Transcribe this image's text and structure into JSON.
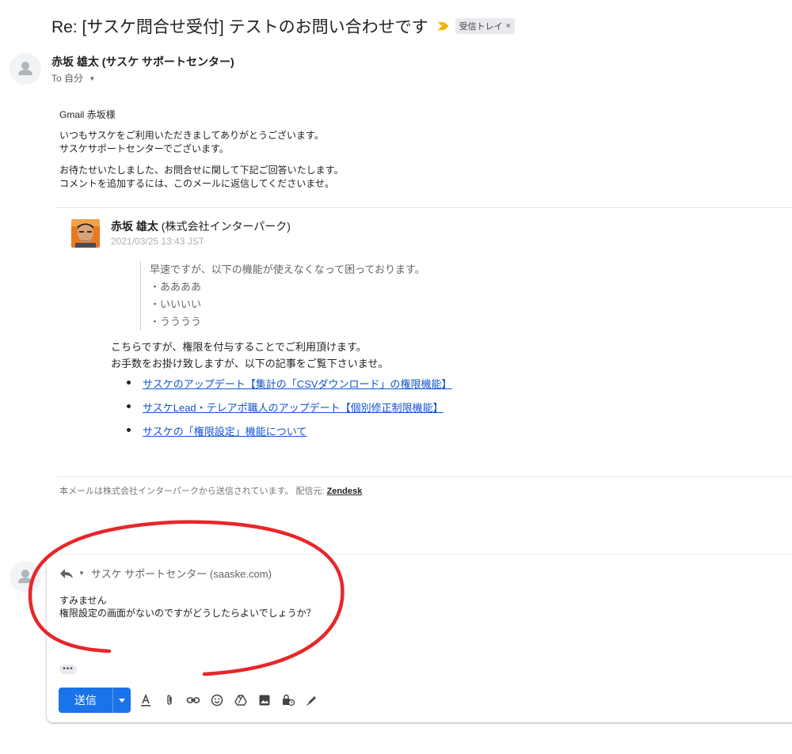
{
  "subject": "Re: [サスケ問合せ受付] テストのお問い合わせです",
  "label": {
    "name": "受信トレイ",
    "close": "×"
  },
  "message": {
    "sender": "赤坂 雄太 (サスケ サポートセンター)",
    "to": "To 自分",
    "greeting": "Gmail 赤坂様",
    "intro": [
      "いつもサスケをご利用いただきましてありがとうございます。",
      "サスケサポートセンターでございます。"
    ],
    "notice": [
      "お待たせいたしました、お問合せに関して下記ご回答いたします。",
      "コメントを追加するには、このメールに返信してくださいませ。"
    ]
  },
  "quoted": {
    "name": "赤坂 雄太",
    "company": " (株式会社インターパーク)",
    "date": "2021/03/25 13:43 JST",
    "lines": [
      "早速ですが、以下の機能が使えなくなって困っております。",
      "・ああああ",
      "・いいいい",
      "・うううう"
    ]
  },
  "answer": {
    "lines": [
      "こちらですが、権限を付与することでご利用頂けます。",
      "お手数をお掛け致しますが、以下の記事をご覧下さいませ。"
    ],
    "links": [
      "サスケのアップデート【集計の「CSVダウンロード」の権限機能】",
      "サスケLead・テレアポ職人のアップデート【個別修正制限機能】",
      "サスケの「権限設定」機能について"
    ]
  },
  "footer": {
    "text": "本メールは株式会社インターパークから送信されています。 配信元:",
    "brand": "Zendesk"
  },
  "compose": {
    "from": "サスケ サポートセンター (saaske.com)",
    "body": [
      "すみません",
      "権限設定の画面がないのですがどうしたらよいでしょうか？"
    ],
    "ellipsis": "•••",
    "send": "送信"
  },
  "colors": {
    "primary": "#1a73e8",
    "link": "#1155cc",
    "label_marker": "#f4b400",
    "annotation": "#e8262a"
  }
}
